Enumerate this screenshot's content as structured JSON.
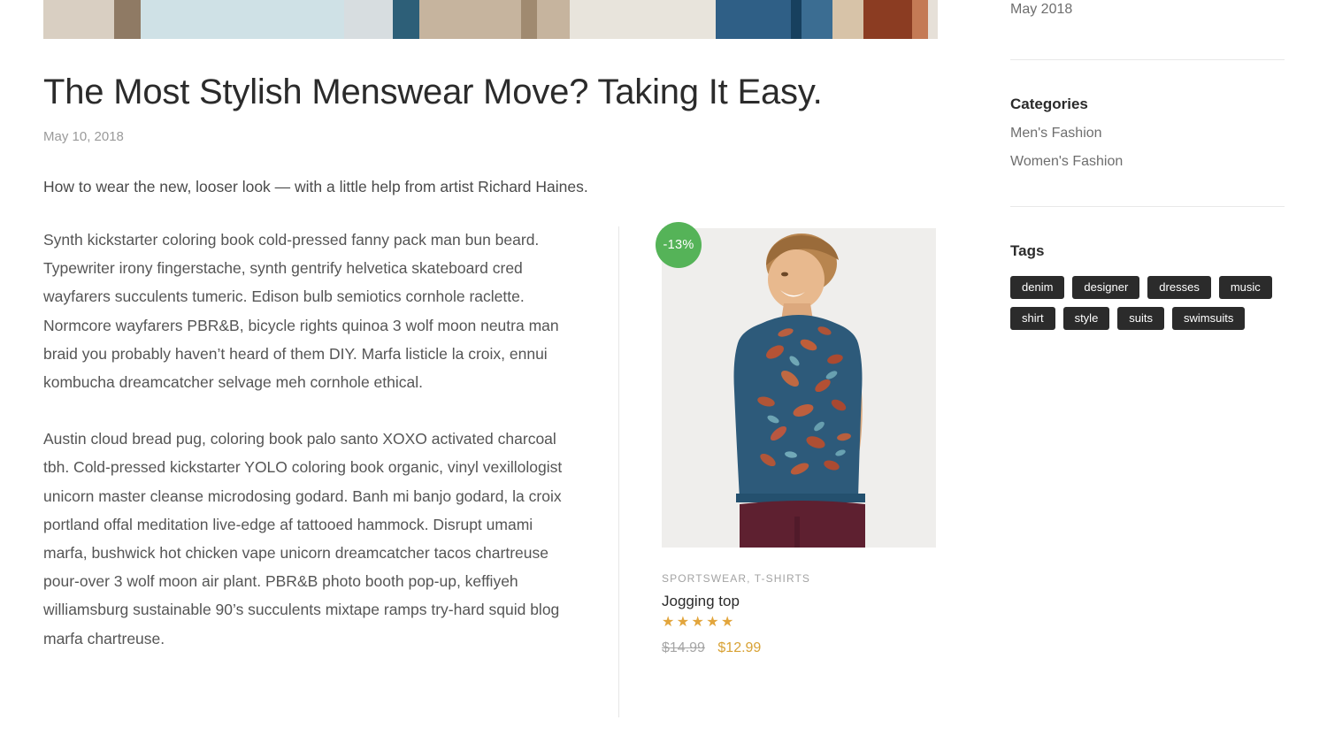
{
  "hero": {
    "alt": "menswear-banner-photo"
  },
  "post": {
    "title": "The Most Stylish Menswear Move? Taking It Easy.",
    "date": "May 10, 2018",
    "excerpt": "How to wear the new, looser look — with a little help from artist Richard Haines.",
    "paragraphs": [
      "Synth kickstarter coloring book cold-pressed fanny pack man bun beard. Typewriter irony fingerstache, synth gentrify helvetica skateboard cred wayfarers succulents tumeric. Edison bulb semiotics cornhole raclette. Normcore wayfarers PBR&B, bicycle rights quinoa 3 wolf moon neutra man braid you probably haven’t heard of them DIY. Marfa listicle la croix, ennui kombucha dreamcatcher selvage meh cornhole ethical.",
      "Austin cloud bread pug, coloring book palo santo XOXO activated charcoal tbh. Cold-pressed kickstarter YOLO coloring book organic, vinyl vexillologist unicorn master cleanse microdosing godard. Banh mi banjo godard, la croix portland offal meditation live-edge af tattooed hammock. Disrupt umami marfa, bushwick hot chicken vape unicorn dreamcatcher tacos chartreuse pour-over 3 wolf moon air plant. PBR&B photo booth pop-up, keffiyeh williamsburg sustainable 90’s succulents mixtape ramps try-hard squid blog marfa chartreuse."
    ]
  },
  "product": {
    "badge": "-13%",
    "badge_color": "#55b358",
    "categories": "SPORTSWEAR, T-SHIRTS",
    "name": "Jogging top",
    "rating_stars": "★★★★★",
    "rating_value": 5,
    "star_color": "#e2a53c",
    "price_old": "$14.99",
    "price_new": "$12.99",
    "price_new_color": "#d8a235",
    "image_alt": "man-wearing-blue-floral-t-shirt"
  },
  "sidebar": {
    "archive": {
      "items": [
        "May 2018"
      ]
    },
    "categories": {
      "heading": "Categories",
      "items": [
        "Men's Fashion",
        "Women's Fashion"
      ]
    },
    "tags": {
      "heading": "Tags",
      "items": [
        "denim",
        "designer",
        "dresses",
        "music",
        "shirt",
        "style",
        "suits",
        "swimsuits"
      ],
      "background": "#2b2b2b"
    }
  }
}
